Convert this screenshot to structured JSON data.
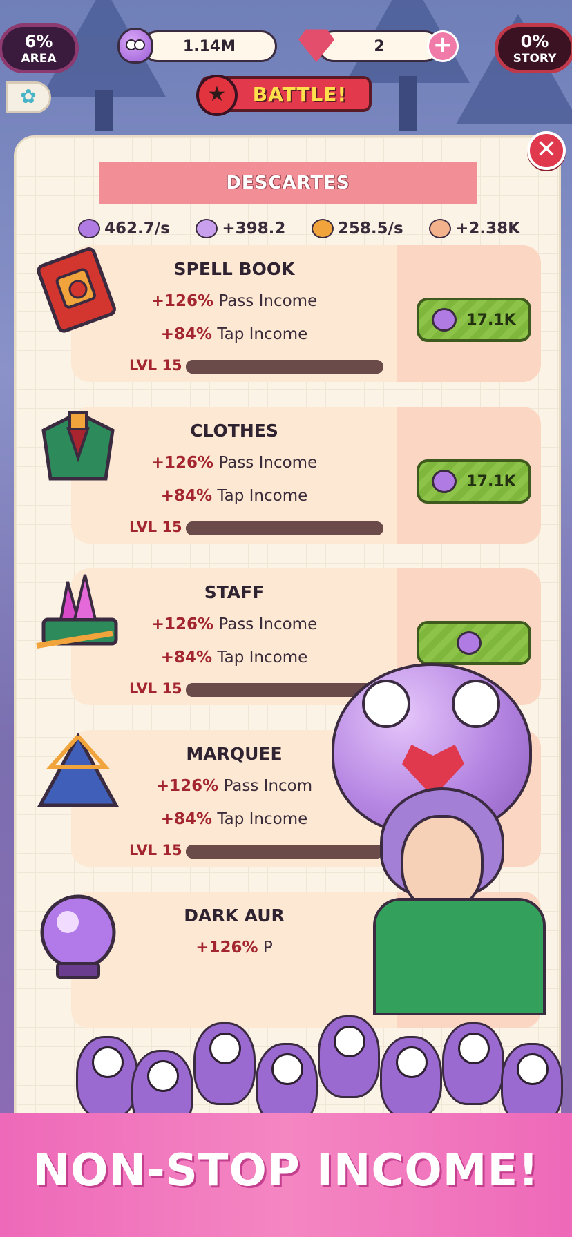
{
  "hud": {
    "area": {
      "value": "6%",
      "label": "AREA"
    },
    "story": {
      "value": "0%",
      "label": "STORY"
    },
    "garlic_count": "1.14M",
    "gem_count": "2",
    "plus_icon": "plus-icon",
    "settings_icon": "flower-gear-icon",
    "battle_label": "BATTLE!"
  },
  "panel": {
    "title": "DESCARTES",
    "close_glyph": "✕",
    "stats": [
      {
        "icon": "garlic-group-icon",
        "value": "462.7/s"
      },
      {
        "icon": "tap-fist-icon",
        "value": "+398.2"
      },
      {
        "icon": "gold-coin-icon",
        "value": "258.5/s"
      },
      {
        "icon": "hand-icon",
        "value": "+2.38K"
      }
    ]
  },
  "items": [
    {
      "name": "SPELL BOOK",
      "pass_pct": "+126%",
      "pass_label": "Pass Income",
      "tap_pct": "+84%",
      "tap_label": "Tap Income",
      "level": "LVL 15",
      "progress": 1.0,
      "price": "17.1K",
      "icon": "spell-book-icon"
    },
    {
      "name": "CLOTHES",
      "pass_pct": "+126%",
      "pass_label": "Pass Income",
      "tap_pct": "+84%",
      "tap_label": "Tap Income",
      "level": "LVL 15",
      "progress": 1.0,
      "price": "17.1K",
      "icon": "clothes-icon"
    },
    {
      "name": "STAFF",
      "pass_pct": "+126%",
      "pass_label": "Pass Income",
      "tap_pct": "+84%",
      "tap_label": "Tap Income",
      "level": "LVL 15",
      "progress": 1.0,
      "price": "",
      "icon": "crystal-staff-icon"
    },
    {
      "name": "MARQUEE",
      "pass_pct": "+126%",
      "pass_label": "Pass Incom",
      "tap_pct": "+84%",
      "tap_label": "Tap Income",
      "level": "LVL 15",
      "progress": 1.0,
      "price": "",
      "icon": "marquee-tent-icon"
    },
    {
      "name": "DARK AUR",
      "pass_pct": "+126%",
      "pass_label": "P",
      "tap_pct": "",
      "tap_label": "",
      "level": "",
      "progress": 0,
      "price": "",
      "icon": "crystal-ball-icon"
    }
  ],
  "promo": {
    "text": "NON-STOP INCOME!"
  },
  "colors": {
    "accent_red": "#e0384c",
    "buy_green": "#8dc348",
    "promo_pink": "#ee69b9",
    "panel_bg": "#fbf4e6"
  }
}
